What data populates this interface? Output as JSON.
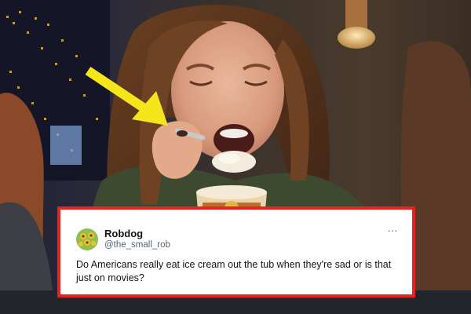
{
  "tweet": {
    "display_name": "Robdog",
    "handle": "@the_small_rob",
    "text": "Do Americans really eat ice cream out the tub when they're sad or is that just on movies?",
    "more_label": "···",
    "avatar_icon": "sunflower-avatar"
  },
  "colors": {
    "highlight_border": "#e8221f",
    "arrow": "#f5e61c",
    "name_text": "#0f1419",
    "handle_text": "#536471"
  }
}
